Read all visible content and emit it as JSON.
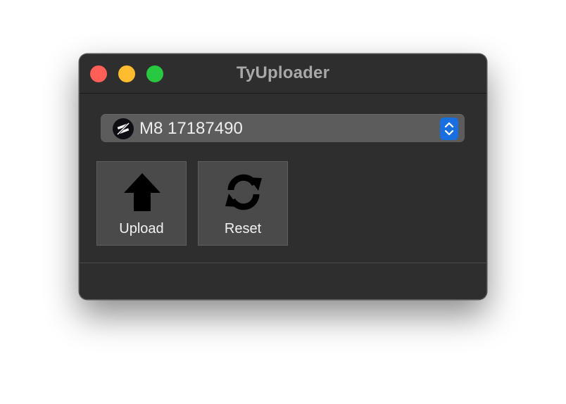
{
  "window": {
    "title": "TyUploader"
  },
  "device_select": {
    "selected": "M8 17187490",
    "icon": "board-icon"
  },
  "toolbar": {
    "upload_label": "Upload",
    "upload_icon": "up-arrow-icon",
    "reset_label": "Reset",
    "reset_icon": "refresh-icon"
  },
  "colors": {
    "close": "#ff5f57",
    "minimize": "#febc2e",
    "maximize": "#28c840",
    "accent": "#1a6fe0",
    "window_bg": "#2e2e2e"
  }
}
